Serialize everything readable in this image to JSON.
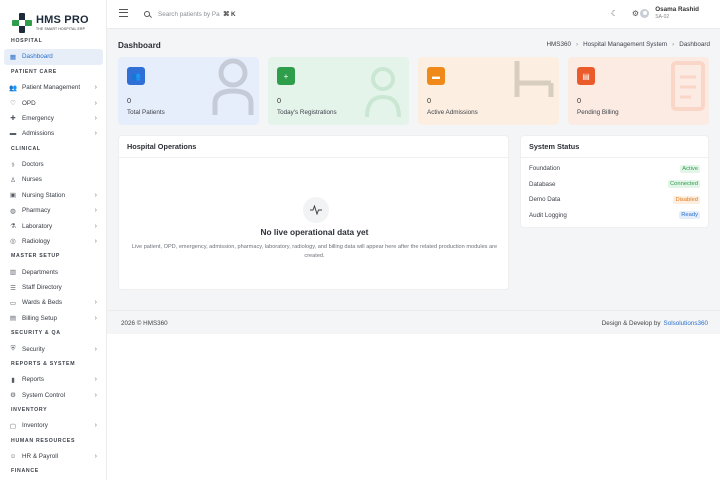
{
  "brand": {
    "title": "HMS PRO",
    "subtitle": "THE SMART HOSPITAL ERP"
  },
  "sidebar": {
    "sections": [
      {
        "label": "HOSPITAL",
        "items": [
          {
            "label": "Dashboard",
            "icon": "grid-icon",
            "active": true,
            "chevron": false
          }
        ]
      },
      {
        "label": "PATIENT CARE",
        "items": [
          {
            "label": "Patient Management",
            "icon": "users-icon",
            "chevron": true
          },
          {
            "label": "OPD",
            "icon": "stethoscope-icon",
            "chevron": true
          },
          {
            "label": "Emergency",
            "icon": "ambulance-icon",
            "chevron": true
          },
          {
            "label": "Admissions",
            "icon": "bed-icon",
            "chevron": true
          }
        ]
      },
      {
        "label": "CLINICAL",
        "items": [
          {
            "label": "Doctors",
            "icon": "doctor-icon",
            "chevron": false
          },
          {
            "label": "Nurses",
            "icon": "nurse-icon",
            "chevron": false
          },
          {
            "label": "Nursing Station",
            "icon": "station-icon",
            "chevron": true
          },
          {
            "label": "Pharmacy",
            "icon": "pill-icon",
            "chevron": true
          },
          {
            "label": "Laboratory",
            "icon": "flask-icon",
            "chevron": true
          },
          {
            "label": "Radiology",
            "icon": "radiology-icon",
            "chevron": true
          }
        ]
      },
      {
        "label": "MASTER SETUP",
        "items": [
          {
            "label": "Departments",
            "icon": "building-icon",
            "chevron": false
          },
          {
            "label": "Staff Directory",
            "icon": "directory-icon",
            "chevron": false
          },
          {
            "label": "Wards & Beds",
            "icon": "ward-icon",
            "chevron": true
          },
          {
            "label": "Billing Setup",
            "icon": "billing-icon",
            "chevron": true
          }
        ]
      },
      {
        "label": "SECURITY & QA",
        "items": [
          {
            "label": "Security",
            "icon": "shield-icon",
            "chevron": true
          }
        ]
      },
      {
        "label": "REPORTS & SYSTEM",
        "items": [
          {
            "label": "Reports",
            "icon": "chart-icon",
            "chevron": true
          },
          {
            "label": "System Control",
            "icon": "gear-icon",
            "chevron": true
          }
        ]
      },
      {
        "label": "INVENTORY",
        "items": [
          {
            "label": "Inventory",
            "icon": "box-icon",
            "chevron": true
          }
        ]
      },
      {
        "label": "HUMAN RESOURCES",
        "items": [
          {
            "label": "HR & Payroll",
            "icon": "hr-icon",
            "chevron": true
          }
        ]
      },
      {
        "label": "FINANCE",
        "items": []
      }
    ]
  },
  "topbar": {
    "search_placeholder": "Search patients by Pa",
    "shortcut": "⌘ K",
    "user_name": "Osama Rashid",
    "user_id": "SA-02"
  },
  "page": {
    "title": "Dashboard",
    "breadcrumbs": [
      "HMS360",
      "Hospital Management System",
      "Dashboard"
    ]
  },
  "stats": [
    {
      "value": "0",
      "label": "Total Patients",
      "color": "#2f6fd6",
      "bg": "#e7eefb",
      "icon": "users-icon"
    },
    {
      "value": "0",
      "label": "Today's Registrations",
      "color": "#2e9e4a",
      "bg": "#e5f4ea",
      "icon": "user-add-icon"
    },
    {
      "value": "0",
      "label": "Active Admissions",
      "color": "#ef8a1a",
      "bg": "#fcefe1",
      "icon": "bed-icon"
    },
    {
      "value": "0",
      "label": "Pending Billing",
      "color": "#ea5a2a",
      "bg": "#fcebe3",
      "icon": "invoice-icon"
    }
  ],
  "operations": {
    "title": "Hospital Operations",
    "empty_title": "No live operational data yet",
    "empty_desc": "Live patient, OPD, emergency, admission, pharmacy, laboratory, radiology, and billing data will appear here after the related production modules are created."
  },
  "system_status": {
    "title": "System Status",
    "rows": [
      {
        "label": "Foundation",
        "status": "Active",
        "color": "#2e9e4a",
        "bg": "#e3f5e8"
      },
      {
        "label": "Database",
        "status": "Connected",
        "color": "#2e9e4a",
        "bg": "#e3f5e8"
      },
      {
        "label": "Demo Data",
        "status": "Disabled",
        "color": "#e07a1a",
        "bg": "#fcefe1"
      },
      {
        "label": "Audit Logging",
        "status": "Ready",
        "color": "#2a6fc9",
        "bg": "#e5eefb"
      }
    ]
  },
  "footer": {
    "copyright": "2026 © HMS360",
    "credit": "Design & Develop by",
    "credit_brand": "Solsolutions360"
  }
}
